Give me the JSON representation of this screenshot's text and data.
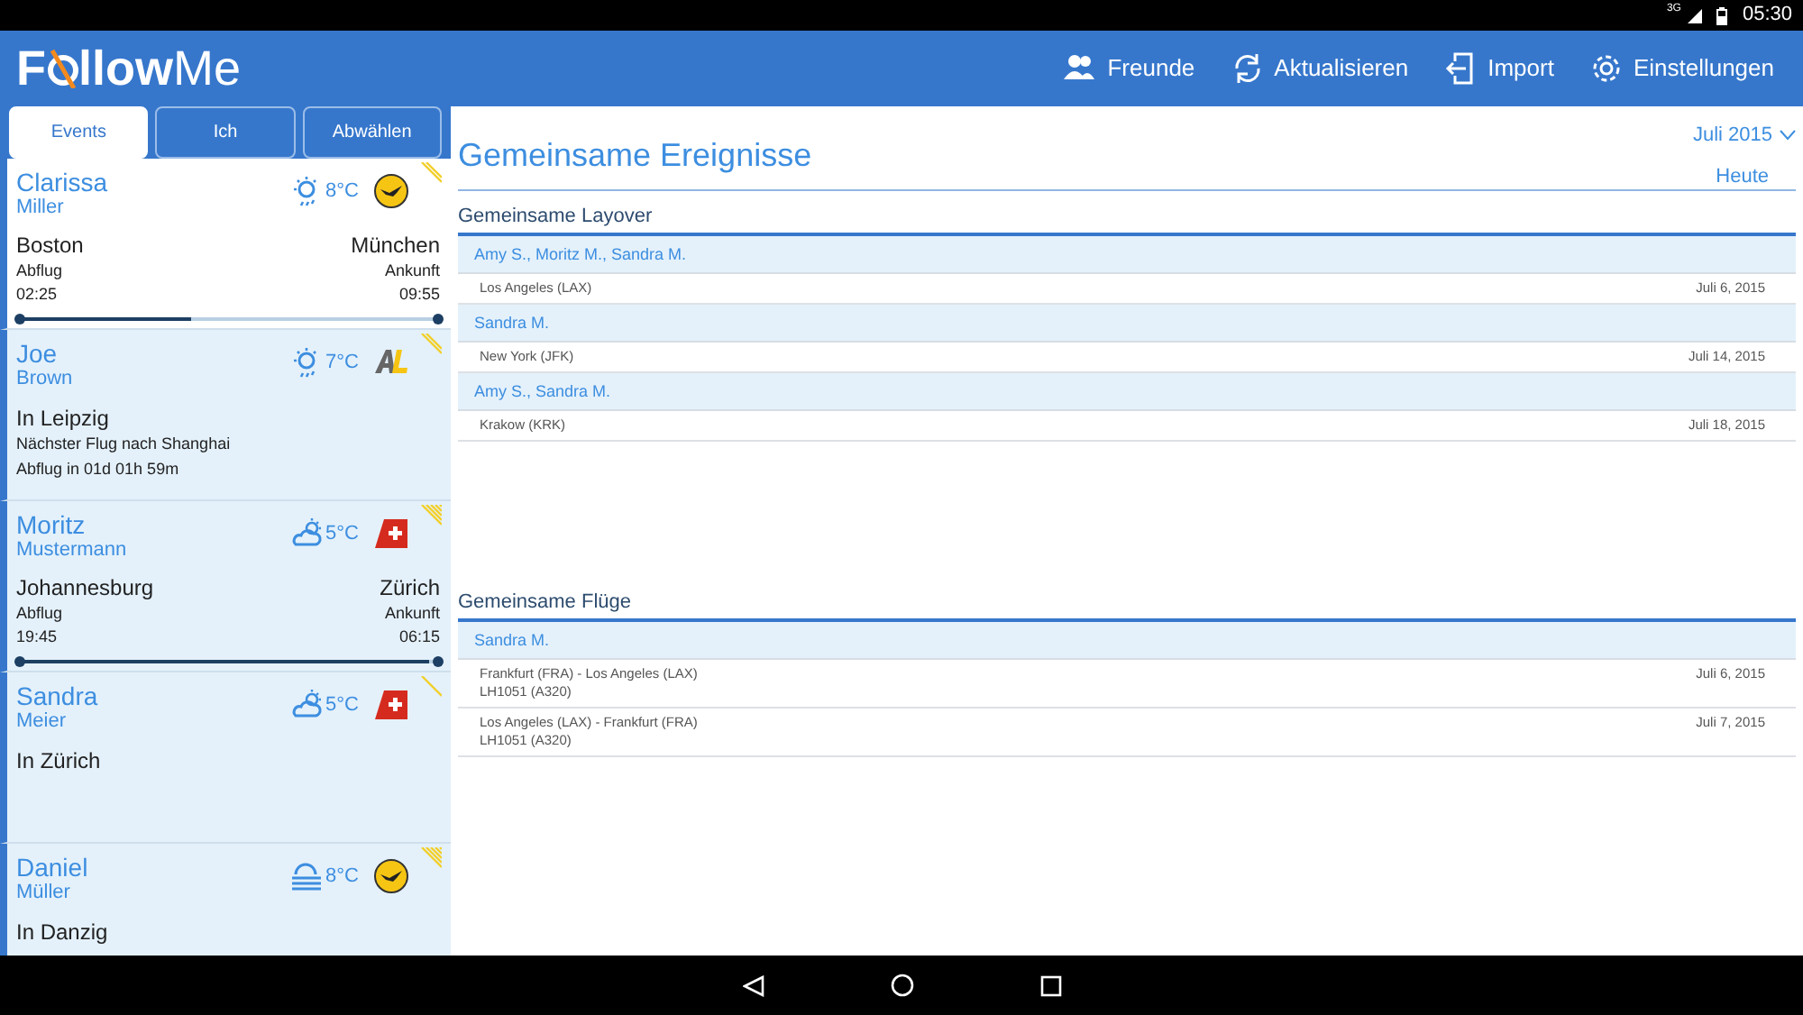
{
  "status_bar": {
    "network": "3G",
    "time": "05:30"
  },
  "app_bar": {
    "logo": {
      "start": "F",
      "bold": "llow",
      "light": "Me"
    },
    "actions": [
      {
        "label": "Freunde"
      },
      {
        "label": "Aktualisieren"
      },
      {
        "label": "Import"
      },
      {
        "label": "Einstellungen"
      }
    ]
  },
  "tabs": [
    {
      "label": "Events",
      "selected": true
    },
    {
      "label": "Ich",
      "selected": false
    },
    {
      "label": "Abwählen",
      "selected": false
    }
  ],
  "friends": [
    {
      "kind": "flight",
      "first_name": "Clarissa",
      "last_name": "Miller",
      "temperature": "8°C",
      "selected": true,
      "from": "Boston",
      "to": "München",
      "departure_label": "Abflug",
      "arrival_label": "Ankunft",
      "departure_time": "02:25",
      "arrival_time": "09:55",
      "level": 0.41
    },
    {
      "kind": "location",
      "first_name": "Joe",
      "last_name": "Brown",
      "temperature": "7°C",
      "selected": false,
      "status": "In Leipzig",
      "lines": [
        "Nächster Flug nach Shanghai",
        "Abflug in 01d 01h 59m"
      ]
    },
    {
      "kind": "flight",
      "first_name": "Moritz",
      "last_name": "Mustermann",
      "temperature": "5°C",
      "selected": false,
      "from": "Johannesburg",
      "to": "Zürich",
      "departure_label": "Abflug",
      "arrival_label": "Ankunft",
      "departure_time": "19:45",
      "arrival_time": "06:15",
      "level": 0.98
    },
    {
      "kind": "location",
      "first_name": "Sandra",
      "last_name": "Meier",
      "temperature": "5°C",
      "selected": false,
      "status": "In Zürich"
    },
    {
      "kind": "location",
      "first_name": "Daniel",
      "last_name": "Müller",
      "temperature": "8°C",
      "selected": false,
      "status": "In Danzig"
    }
  ],
  "main": {
    "title": "Gemeinsame Ereignisse",
    "month": "Juli 2015",
    "today": "Heute",
    "sections": [
      {
        "title": "Gemeinsame Layover",
        "groups": [
          {
            "people": "Amy S., Moritz M., Sandra M.",
            "items": [
              {
                "lines": [
                  "Los Angeles (LAX)"
                ],
                "date": "Juli 6, 2015"
              }
            ]
          },
          {
            "people": "Sandra M.",
            "items": [
              {
                "lines": [
                  "New York (JFK)"
                ],
                "date": "Juli 14, 2015"
              }
            ]
          },
          {
            "people": "Amy S., Sandra M.",
            "items": [
              {
                "lines": [
                  "Krakow (KRK)"
                ],
                "date": "Juli 18, 2015"
              }
            ]
          }
        ]
      },
      {
        "title": "Gemeinsame Flüge",
        "groups": [
          {
            "people": "Sandra M.",
            "items": [
              {
                "lines": [
                  "Frankfurt (FRA) - Los Angeles (LAX)",
                  "LH1051 (A320)"
                ],
                "date": "Juli 6, 2015"
              },
              {
                "lines": [
                  "Los Angeles (LAX) - Frankfurt (FRA)",
                  "LH1051 (A320)"
                ],
                "date": "Juli 7, 2015"
              }
            ]
          }
        ]
      }
    ]
  }
}
